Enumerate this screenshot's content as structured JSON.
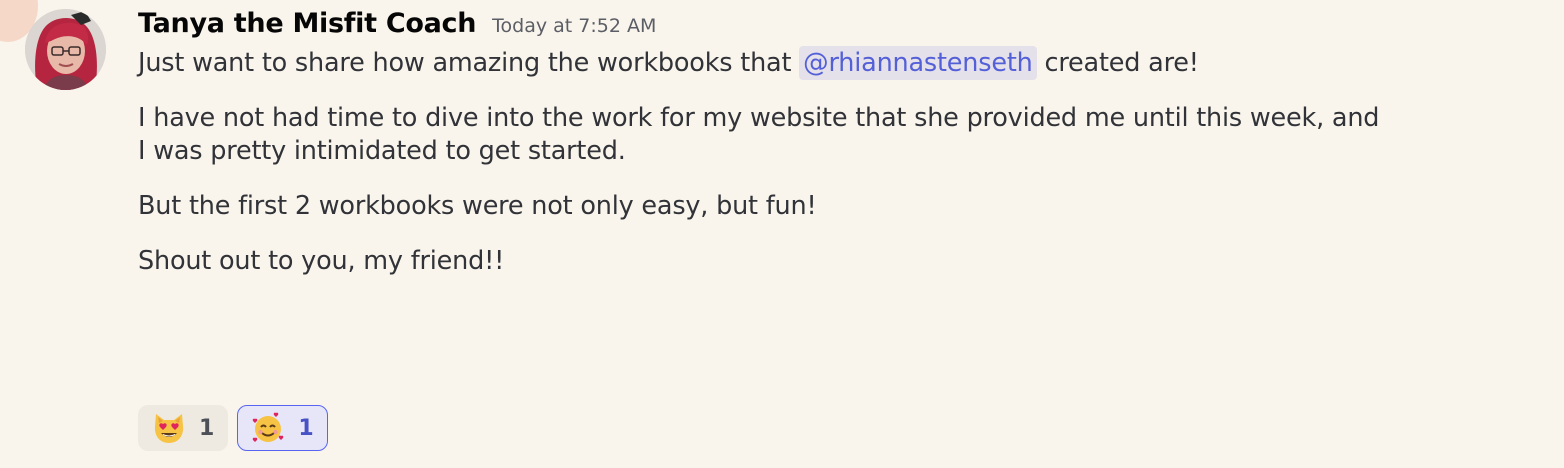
{
  "message": {
    "author": "Tanya the Misfit Coach",
    "timestamp": "Today at 7:52 AM",
    "line1_before": "Just want to share how amazing the workbooks that ",
    "mention": "@rhiannastenseth",
    "line1_after": " created are!",
    "paragraph2_line1": "I have not had time to dive into the work for my website that she provided me until this week, and",
    "paragraph2_line2": "I was pretty intimidated to get started.",
    "paragraph3": "But the first 2 workbooks were not only easy, but fun!",
    "paragraph4": "Shout out to you, my friend!!"
  },
  "reactions": [
    {
      "icon": "heart-eyes-cat-icon",
      "count": "1",
      "selected": false
    },
    {
      "icon": "smiling-face-with-hearts-icon",
      "count": "1",
      "selected": true
    }
  ],
  "colors": {
    "background": "#f9f5ec",
    "mention_text": "#5460d8",
    "mention_bg": "#e5e1ea",
    "selected_reaction_border": "#5865f2"
  }
}
